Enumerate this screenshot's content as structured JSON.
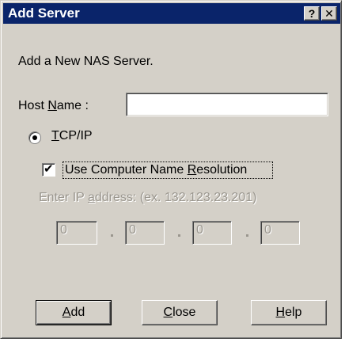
{
  "window": {
    "title": "Add Server",
    "help_button": "?",
    "close_button": "✕"
  },
  "intro": "Add a New NAS Server.",
  "host_name": {
    "label_pre": "Host ",
    "label_accel": "N",
    "label_post": "ame :",
    "value": ""
  },
  "protocol": {
    "accel": "T",
    "label_rest": "CP/IP",
    "selected": true
  },
  "name_resolution": {
    "label_pre": "Use Computer Name ",
    "label_accel": "R",
    "label_post": "esolution",
    "checked": true,
    "check_glyph": "✔"
  },
  "ip": {
    "hint_pre": "Enter IP ",
    "hint_accel": "a",
    "hint_post": "ddress: (ex. 132.123.23.201)",
    "octets": [
      "0",
      "0",
      "0",
      "0"
    ]
  },
  "buttons": {
    "add_accel": "A",
    "add_rest": "dd",
    "close_accel": "C",
    "close_rest": "lose",
    "help_accel": "H",
    "help_rest": "elp"
  },
  "colors": {
    "face": "#d4d0c8",
    "titlebar": "#0a246a",
    "disabled_text": "#9a968e"
  }
}
